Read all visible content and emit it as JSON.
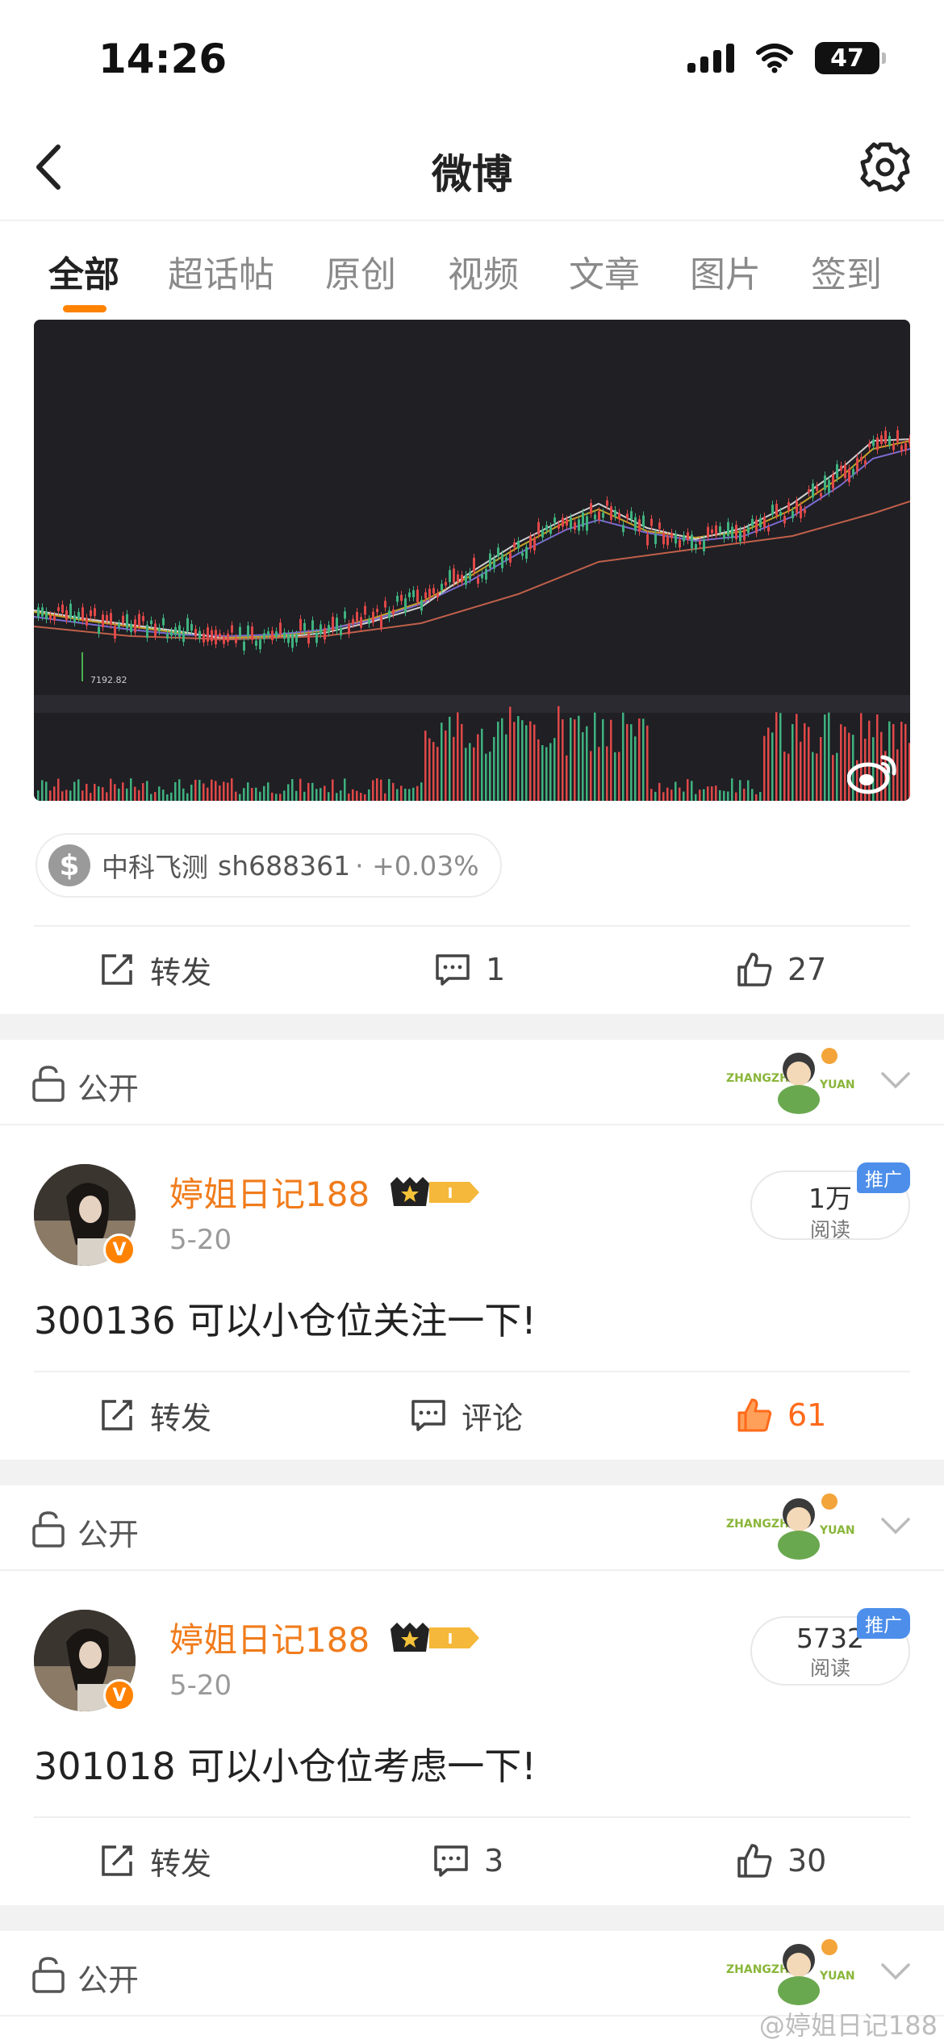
{
  "status_bar": {
    "time": "14:26",
    "battery": "47"
  },
  "nav": {
    "title": "微博"
  },
  "tabs": [
    "全部",
    "超话帖",
    "原创",
    "视频",
    "文章",
    "图片",
    "签到"
  ],
  "chart_card": {
    "price_label": "7192.82"
  },
  "stock_chip": {
    "name": "中科飞测",
    "code": "sh688361",
    "change": "· +0.03%"
  },
  "post0_actions": {
    "repost": "转发",
    "comments": "1",
    "likes": "27"
  },
  "posts": [
    {
      "visibility": "公开",
      "sticker_text": [
        "ZHANGZHE",
        "YUAN"
      ],
      "username": "婷姐日记188",
      "vip_level": "I",
      "date": "5-20",
      "reads": "1万",
      "reads_label": "阅读",
      "promo": "推广",
      "text": "300136 可以小仓位关注一下!",
      "repost": "转发",
      "comments": "评论",
      "likes": "61"
    },
    {
      "visibility": "公开",
      "sticker_text": [
        "ZHANGZHE",
        "YUAN"
      ],
      "username": "婷姐日记188",
      "vip_level": "I",
      "date": "5-20",
      "reads": "5732",
      "reads_label": "阅读",
      "promo": "推广",
      "text": "301018 可以小仓位考虑一下!",
      "repost": "转发",
      "comments": "3",
      "likes": "30"
    }
  ],
  "post3": {
    "visibility": "公开",
    "sticker_text": [
      "ZHANGZHE",
      "YUAN"
    ]
  },
  "watermark": "@婷姐日记188",
  "colors": {
    "accent": "#ff8200",
    "username": "#f07c1c",
    "liked": "#ff6a1a",
    "promo": "#4d8eea"
  }
}
